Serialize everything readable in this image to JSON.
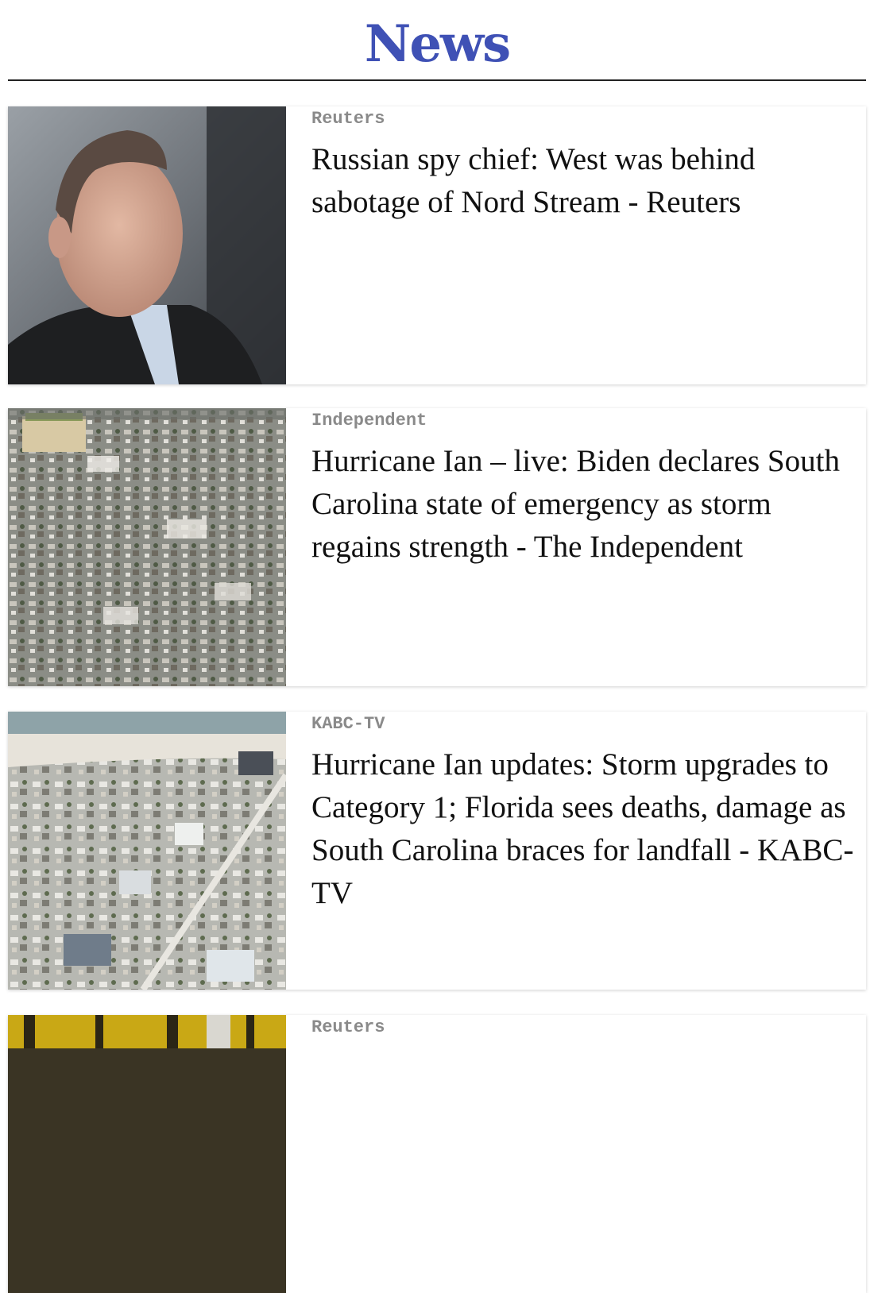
{
  "header": {
    "title": "News"
  },
  "articles": [
    {
      "source": "Reuters",
      "headline": "Russian spy chief: West was behind sabotage of Nord Stream - Reuters",
      "image": "portrait-photo"
    },
    {
      "source": "Independent",
      "headline": "Hurricane Ian – live: Biden declares South Carolina state of emergency as storm regains strength - The Independent",
      "image": "aerial-damage-photo"
    },
    {
      "source": "KABC-TV",
      "headline": "Hurricane Ian updates: Storm upgrades to Category 1; Florida sees deaths, damage as South Carolina braces for landfall - KABC-TV",
      "image": "aerial-coast-photo"
    },
    {
      "source": "Reuters",
      "headline": "",
      "image": "industrial-photo"
    }
  ]
}
